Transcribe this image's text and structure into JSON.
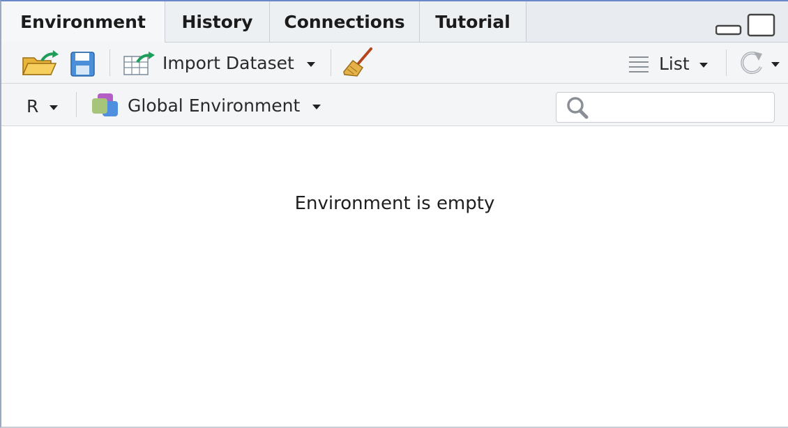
{
  "tabs": [
    {
      "label": "Environment",
      "active": true
    },
    {
      "label": "History",
      "active": false
    },
    {
      "label": "Connections",
      "active": false
    },
    {
      "label": "Tutorial",
      "active": false
    }
  ],
  "toolbar": {
    "import_dataset_label": "Import Dataset",
    "view_mode_label": "List",
    "icons": [
      "open-folder-icon",
      "save-icon",
      "import-table-icon",
      "broom-icon",
      "list-lines-icon",
      "refresh-icon"
    ]
  },
  "scope_bar": {
    "language_label": "R",
    "environment_label": "Global Environment",
    "search_placeholder": ""
  },
  "content": {
    "empty_message": "Environment is empty"
  },
  "colors": {
    "accent_border": "#6a88c9",
    "tab_bg": "#e8ecf0",
    "toolbar_bg": "#f3f5f7"
  }
}
